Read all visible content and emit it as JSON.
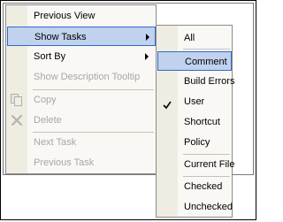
{
  "context_menu": {
    "items": [
      {
        "label": "Previous View",
        "state": "enabled"
      },
      {
        "label": "Show Tasks",
        "state": "highlighted",
        "submenu": true
      },
      {
        "label": "Sort By",
        "state": "enabled",
        "submenu": true
      },
      {
        "label": "Show Description Tooltip",
        "state": "disabled"
      },
      {
        "label": "Copy",
        "state": "disabled",
        "icon": "copy-icon"
      },
      {
        "label": "Delete",
        "state": "disabled",
        "icon": "delete-icon"
      },
      {
        "label": "Next Task",
        "state": "disabled"
      },
      {
        "label": "Previous Task",
        "state": "disabled"
      }
    ]
  },
  "tasks_submenu": {
    "items": [
      {
        "label": "All"
      },
      {
        "label": "Comment",
        "state": "highlighted"
      },
      {
        "label": "Build Errors"
      },
      {
        "label": "User",
        "checked": true
      },
      {
        "label": "Shortcut"
      },
      {
        "label": "Policy"
      },
      {
        "label": "Current File"
      },
      {
        "label": "Checked"
      },
      {
        "label": "Unchecked"
      }
    ]
  },
  "colors": {
    "menu_bg": "#f9f8f4",
    "gutter": "#efede2",
    "highlight_bg": "#c1d2ee",
    "highlight_border": "#316ac5",
    "disabled_text": "#a7a6aa"
  }
}
